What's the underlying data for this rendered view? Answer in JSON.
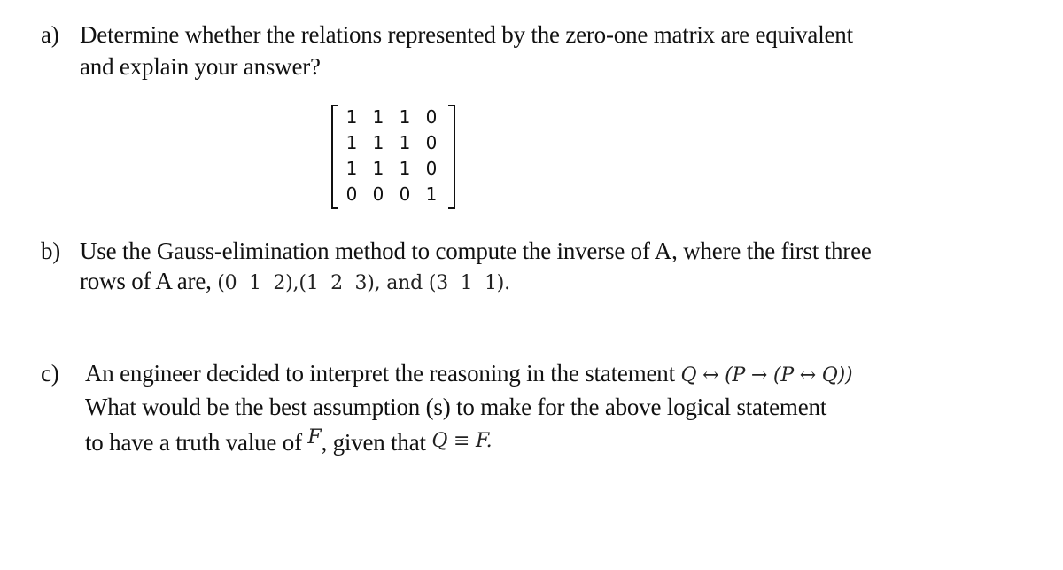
{
  "a": {
    "label": "a)",
    "line1": "Determine whether the relations represented by the zero-one matrix are equivalent",
    "line2": "and explain your answer?",
    "matrix": [
      [
        1,
        1,
        1,
        0
      ],
      [
        1,
        1,
        1,
        0
      ],
      [
        1,
        1,
        1,
        0
      ],
      [
        0,
        0,
        0,
        1
      ]
    ]
  },
  "b": {
    "label": "b)",
    "line1": "Use the Gauss-elimination method to compute the inverse of A, where the first three",
    "line2_text": "rows of A are, ",
    "line2_math": "(0  1  2),(1  2  3), and (3  1  1)."
  },
  "c": {
    "label": "c)",
    "line1_text": "An engineer decided to interpret the reasoning in the statement ",
    "line1_math": "Q ↔ (P → (P ↔ Q))",
    "line2": "What would be the best assumption (s) to make for the above logical statement",
    "line3_text1": "to have a truth value of ",
    "line3_math1": "F",
    "line3_text2": ", given that ",
    "line3_math2": "Q ≡ F."
  }
}
